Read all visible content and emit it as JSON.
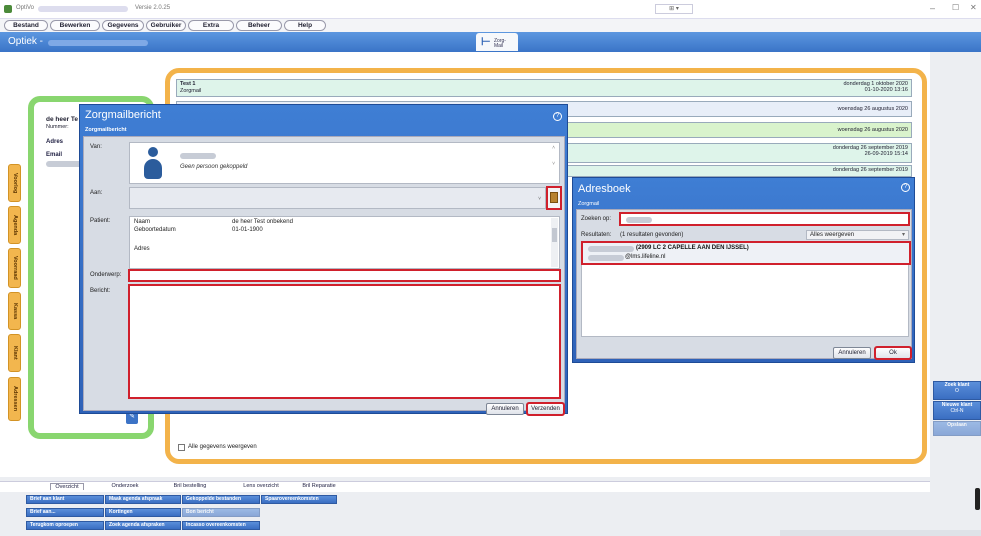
{
  "titlebar": {
    "app_title": "OptiVo",
    "version": "Versie 2.0.25"
  },
  "menu": [
    "Bestand",
    "Bewerken",
    "Gegevens",
    "Gebruiker",
    "Extra",
    "Beheer",
    "Help"
  ],
  "appbar": {
    "title": "Optiek -",
    "tab_label": "Zorg-Mail"
  },
  "customer": {
    "name": "de heer Te",
    "number_label": "Nummer:",
    "address_label": "Adres",
    "email_label": "Email"
  },
  "side_tabs": [
    "Voorlog",
    "Agenda",
    "Voorraad",
    "Kassa",
    "Klant",
    "Adressen"
  ],
  "history_rows": [
    {
      "title": "Test 1",
      "subtitle": "Zorgmail",
      "date": "donderdag 1 oktober 2020",
      "time": "01-10-2020 13:16",
      "color": "#def4ea"
    },
    {
      "title": "",
      "subtitle": "",
      "date": "woensdag 26 augustus 2020",
      "time": "",
      "color": "#e8eef8"
    },
    {
      "title": "",
      "subtitle": "",
      "date": "woensdag 26 augustus 2020",
      "time": "",
      "color": "#d9f3cc"
    },
    {
      "title": "",
      "subtitle": "",
      "date": "donderdag 26 september 2019",
      "time": "26-09-2019 15:14",
      "color": "#def4ea"
    },
    {
      "title": "",
      "subtitle": "",
      "date": "donderdag 26 september 2019",
      "time": "",
      "color": "#def4ea"
    }
  ],
  "show_all_label": "Alle gegevens weergeven",
  "zorgmail": {
    "title": "Zorgmailbericht",
    "subtitle": "Zorgmailbericht",
    "van_label": "Van:",
    "no_person": "Geen persoon gekoppeld",
    "aan_label": "Aan:",
    "patient_label": "Patient:",
    "naam_label": "Naam",
    "naam_value": "de heer Test onbekend",
    "geboortedatum_label": "Geboortedatum",
    "geboortedatum_value": "01-01-1900",
    "adres_label": "Adres",
    "onderwerp_label": "Onderwerp:",
    "bericht_label": "Bericht:",
    "cancel": "Annuleren",
    "send": "Verzenden"
  },
  "adresboek": {
    "title": "Adresboek",
    "subtitle": "Zorgmail",
    "search_label": "Zoeken op:",
    "results_label": "Resultaten:",
    "results_count": "(1 resultaten gevonden)",
    "filter_value": "Alles weergeven",
    "result_line1": "(2909 LC 2 CAPELLE AAN DEN IJSSEL)",
    "result_line2": "@lms.lifeline.nl",
    "cancel": "Annuleren",
    "ok": "Ok"
  },
  "bottom_tabs": [
    "Overzicht",
    "Onderzoek",
    "Bril bestelling",
    "Lens overzicht",
    "Bril Reparatie"
  ],
  "quick_buttons": [
    [
      "Brief aan klant",
      "Maak agenda afspraak",
      "Gekoppelde bestanden",
      "Spaarovereenkomsten"
    ],
    [
      "Brief aan...",
      "Kortingen",
      "Bon bericht"
    ],
    [
      "Terugkom oproepen",
      "Zoek agenda afspraken",
      "Incasso overeenkomsten"
    ]
  ],
  "right_buttons": [
    {
      "label": "Zoek klant",
      "key": "O"
    },
    {
      "label": "Nieuwe klant",
      "key": "Ctrl-N"
    },
    {
      "label": "Opslaan",
      "key": ""
    }
  ]
}
